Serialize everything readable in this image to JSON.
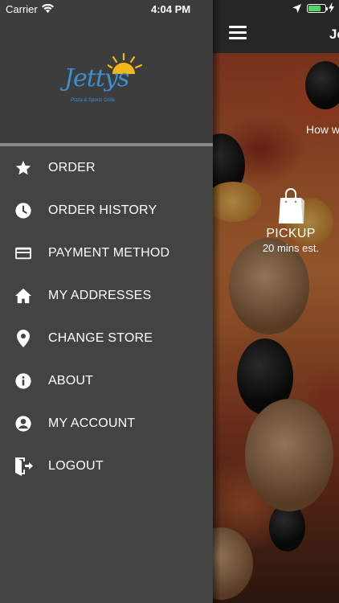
{
  "status_bar": {
    "carrier": "Carrier",
    "time": "4:04 PM",
    "battery_level": 0.75,
    "icons": [
      "wifi-icon",
      "location-arrow-icon",
      "battery-icon",
      "charging-bolt-icon"
    ]
  },
  "app": {
    "title": "Je",
    "prompt_text": "How w",
    "pickup": {
      "label": "PICKUP",
      "time": "20 mins est.",
      "icon": "shopping-bag-icon"
    }
  },
  "drawer": {
    "logo": {
      "brand": "Jettys",
      "tagline": "Pizza & Sports Grille",
      "accent_color": "#3a8fd3",
      "sun_color": "#f2b718"
    },
    "menu_items": [
      {
        "label": "ORDER",
        "icon": "star-icon"
      },
      {
        "label": "ORDER HISTORY",
        "icon": "clock-icon"
      },
      {
        "label": "PAYMENT METHOD",
        "icon": "credit-card-icon"
      },
      {
        "label": "MY ADDRESSES",
        "icon": "home-icon"
      },
      {
        "label": "CHANGE STORE",
        "icon": "location-pin-icon"
      },
      {
        "label": "ABOUT",
        "icon": "info-icon"
      },
      {
        "label": "MY ACCOUNT",
        "icon": "account-circle-icon"
      },
      {
        "label": "LOGOUT",
        "icon": "logout-icon"
      }
    ]
  },
  "colors": {
    "drawer_bg": "#434343",
    "drawer_header_bg": "#3d3d3d",
    "divider": "#8a8a8a",
    "topbar_bg": "#262626",
    "battery_fill": "#4cd964"
  }
}
